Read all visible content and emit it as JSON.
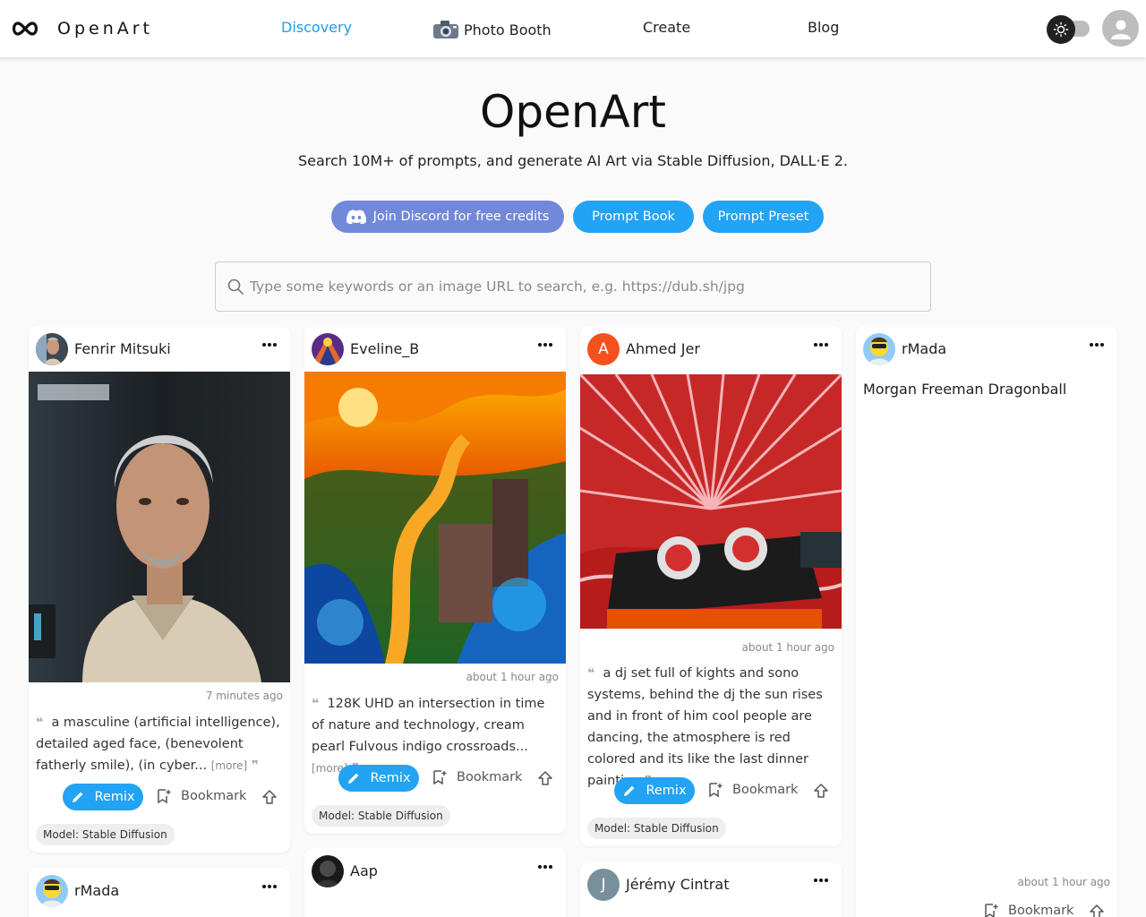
{
  "header": {
    "logo_text": "OpenArt",
    "nav": [
      {
        "label": "Discovery",
        "active": true
      },
      {
        "label": "Photo Booth",
        "icon": "camera-icon"
      },
      {
        "label": "Create"
      },
      {
        "label": "Blog"
      }
    ],
    "theme_toggle_icon": "sun-icon",
    "avatar_icon": "user-icon"
  },
  "hero": {
    "title": "OpenArt",
    "subtitle": "Search 10M+ of prompts, and generate AI Art via Stable Diffusion, DALL·E 2.",
    "buttons": {
      "discord": "Join Discord for free credits",
      "prompt_book": "Prompt Book",
      "prompt_preset": "Prompt Preset"
    }
  },
  "search": {
    "placeholder": "Type some keywords or an image URL to search, e.g. https://dub.sh/jpg",
    "value": ""
  },
  "colors": {
    "accent": "#22a3f3",
    "discord": "#7289da",
    "nav_active": "#1e9be9"
  },
  "cards": [
    {
      "user": "Fenrir Mitsuki",
      "time": "7 minutes ago",
      "prompt": "a masculine (artificial intelligence), detailed aged face, (benevolent fatherly smile), (in cyber...",
      "more": "[more]",
      "remix": "Remix",
      "bookmark": "Bookmark",
      "model": "Model: Stable Diffusion"
    },
    {
      "user": "Eveline_B",
      "time": "about 1 hour ago",
      "prompt": "128K UHD an intersection in time of nature and technology, cream pearl Fulvous indigo crossroads...",
      "more": "[more]",
      "remix": "Remix",
      "bookmark": "Bookmark",
      "model": "Model: Stable Diffusion"
    },
    {
      "user": "Ahmed Jer",
      "avatar_letter": "A",
      "time": "about 1 hour ago",
      "prompt": "a dj set full of kights and sono systems, behind the dj the sun rises and in front of him cool people are dancing, the atmosphere is red colored and its like the last dinner painting",
      "remix": "Remix",
      "bookmark": "Bookmark",
      "model": "Model: Stable Diffusion"
    },
    {
      "user": "rMada",
      "title": "Morgan Freeman Dragonball",
      "time": "about 1 hour ago",
      "bookmark": "Bookmark"
    },
    {
      "user": "rMada"
    },
    {
      "user": "Aap"
    },
    {
      "user": "Jérémy Cintrat",
      "avatar_letter": "J"
    }
  ],
  "quote_open": "❝",
  "quote_close": "❞"
}
